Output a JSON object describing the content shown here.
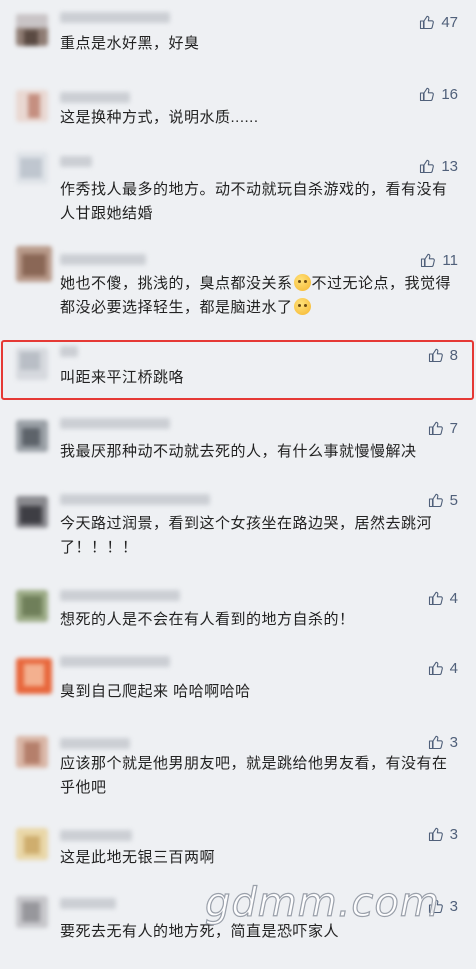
{
  "colors": {
    "background": "#eef0f3",
    "like": "#50607a",
    "highlight": "#e53935"
  },
  "icons": {
    "like": "thumbs-up-icon"
  },
  "comments": [
    {
      "likes": "47",
      "text": "重点是水好黑，好臭"
    },
    {
      "likes": "16",
      "text": "这是换种方式，说明水质......"
    },
    {
      "likes": "13",
      "text": "作秀找人最多的地方。动不动就玩自杀游戏的，看有没有人甘跟她结婚"
    },
    {
      "likes": "11",
      "text_a": "她也不傻，挑浅的，臭点都没关系",
      "text_b": "不过无论点，我觉得都没必要选择轻生，都是脑进水了",
      "emoji_a": "crying-laughing-emoji",
      "emoji_b": "pleading-emoji"
    },
    {
      "likes": "8",
      "text": "叫距来平江桥跳咯",
      "highlighted": true
    },
    {
      "likes": "7",
      "text": "我最厌那种动不动就去死的人，有什么事就慢慢解决"
    },
    {
      "likes": "5",
      "text": "今天路过润景，看到这个女孩坐在路边哭，居然去跳河了！！！！"
    },
    {
      "likes": "4",
      "text": "想死的人是不会在有人看到的地方自杀的！"
    },
    {
      "likes": "4",
      "text": "臭到自己爬起来  哈哈啊哈哈"
    },
    {
      "likes": "3",
      "text": "应该那个就是他男朋友吧，就是跳给他男友看，有没有在乎他吧"
    },
    {
      "likes": "3",
      "text": "这是此地无银三百两啊"
    },
    {
      "likes": "3",
      "text": "要死去无有人的地方死，简直是恐吓家人"
    }
  ],
  "watermark": "gdmm.com"
}
